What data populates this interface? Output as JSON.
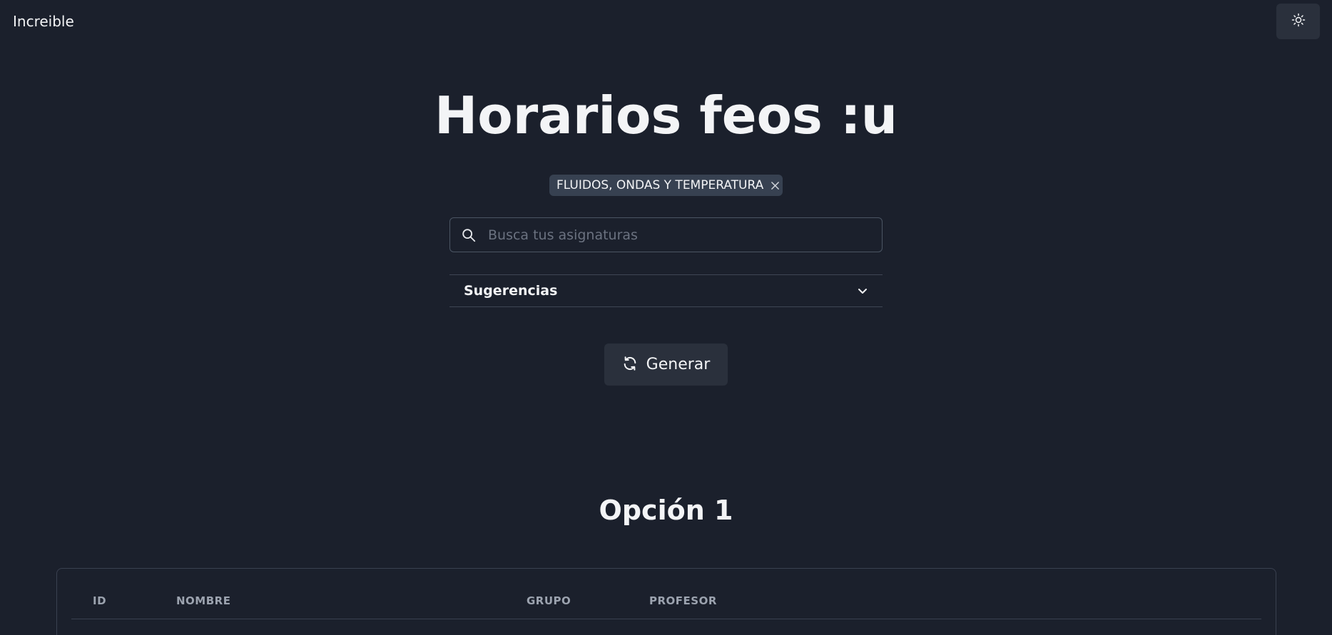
{
  "header": {
    "brand": "Increible",
    "theme_icon": "sun-icon"
  },
  "main": {
    "title": "Horarios feos :u",
    "selected_subjects": [
      {
        "label": "FLUIDOS, ONDAS Y TEMPERATURA",
        "remove_icon": "close-icon"
      }
    ],
    "search": {
      "placeholder": "Busca tus asignaturas",
      "value": "",
      "icon": "search-icon"
    },
    "suggestions": {
      "label": "Sugerencias",
      "icon": "chevron-down-icon",
      "expanded": false
    },
    "generate_button": {
      "label": "Generar",
      "icon": "refresh-icon"
    }
  },
  "results": {
    "option_title": "Opción 1",
    "table": {
      "columns": [
        "ID",
        "NOMBRE",
        "GRUPO",
        "PROFESOR"
      ]
    }
  },
  "colors": {
    "background": "#1b202c",
    "surface": "#2a303c",
    "chip": "#374151",
    "text": "#f3f4f6",
    "muted": "#9ca3af",
    "border": "#4b5563"
  }
}
